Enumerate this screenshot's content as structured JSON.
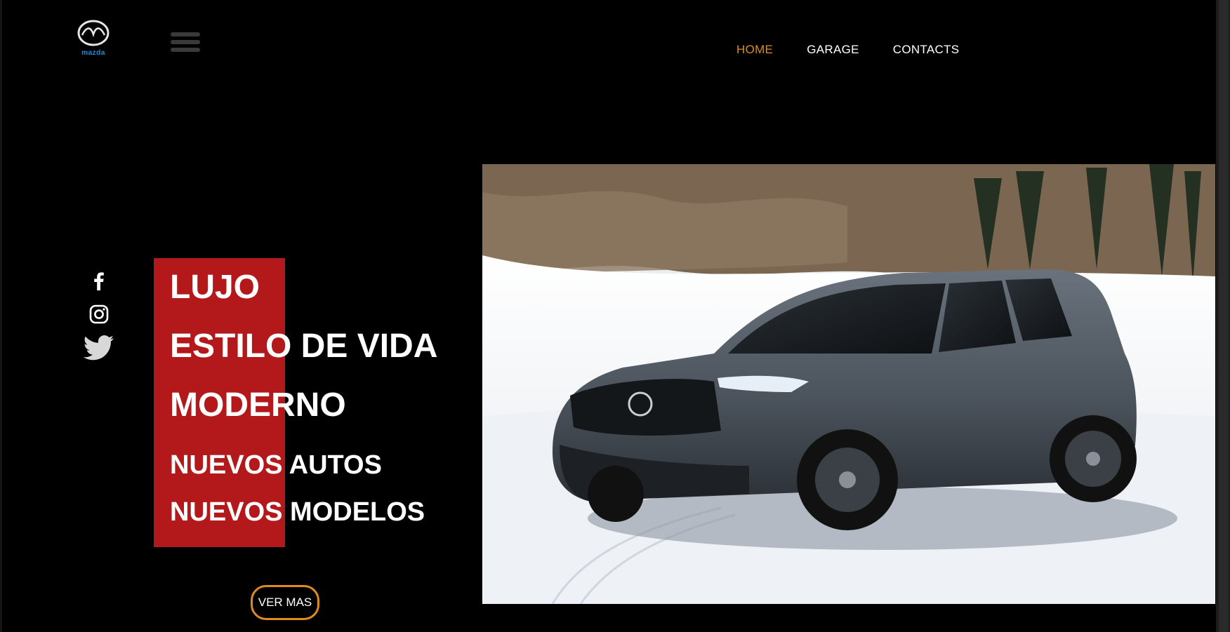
{
  "brand": {
    "name": "mazda",
    "color": "#1a8fd8"
  },
  "nav": {
    "items": [
      {
        "label": "HOME",
        "active": true
      },
      {
        "label": "GARAGE",
        "active": false
      },
      {
        "label": "CONTACTS",
        "active": false
      }
    ],
    "active_color": "#e08a1e"
  },
  "social": {
    "icons": [
      "facebook-icon",
      "instagram-icon",
      "twitter-icon"
    ]
  },
  "hero": {
    "lines": [
      "LUJO",
      "ESTILO DE VIDA",
      "MODERNO"
    ],
    "sublines": [
      "NUEVOS AUTOS",
      "NUEVOS MODELOS"
    ],
    "accent_color": "#b3191a",
    "cta_label": "VER MAS"
  },
  "image": {
    "subject": "grey Mazda SUV on snowy road"
  }
}
